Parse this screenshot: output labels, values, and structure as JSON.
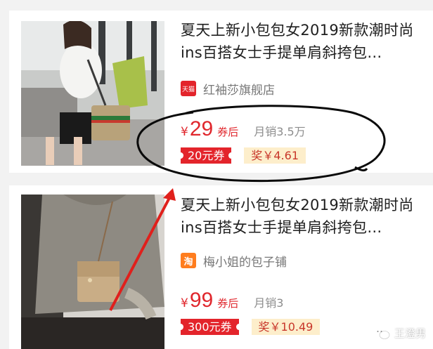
{
  "products": [
    {
      "title": "夏天上新小包包女2019新款潮时尚ins百搭女士手提单肩斜挎包…",
      "shop_logo": "天猫",
      "shop_name": "红袖莎旗舰店",
      "currency": "¥",
      "price": "29",
      "price_suffix": "券后",
      "sales": "月销3.5万",
      "coupon": "20元券",
      "reward": "奖￥4.61"
    },
    {
      "title": "夏天上新小包包女2019新款潮时尚ins百搭女士手提单肩斜挎包…",
      "shop_logo": "淘",
      "shop_name": "梅小姐的包子铺",
      "currency": "¥",
      "price": "99",
      "price_suffix": "券后",
      "sales": "月销3",
      "coupon": "300元券",
      "reward": "奖￥10.49"
    }
  ],
  "watermark": {
    "text": "王澄男"
  },
  "colors": {
    "accent_red": "#e3242b",
    "reward_bg": "#fdeecb",
    "annotation": "#000000",
    "arrow": "#e0201c"
  }
}
